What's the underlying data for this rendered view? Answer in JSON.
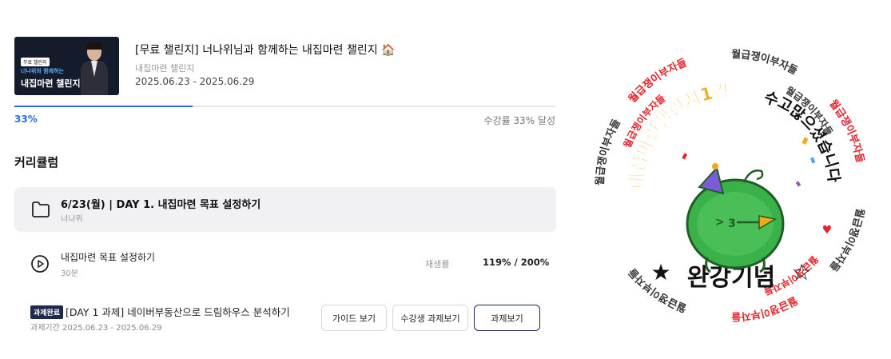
{
  "course": {
    "thumbnail": {
      "tag": "무료 챌린지",
      "subtitle": "너나위와 함께하는",
      "title": "내집마련 챌린지"
    },
    "title": "[무료 챌린지] 너나위님과 함께하는 내집마련 챌린지",
    "title_emoji": "🏠",
    "category": "내집마련 챌린지",
    "period": "2025.06.23 - 2025.06.29"
  },
  "progress": {
    "percent": 33,
    "percent_label": "33%",
    "status_text": "수강률 33% 달성",
    "accent_color": "#2b6de5"
  },
  "curriculum": {
    "heading": "커리큘럼",
    "chapter": {
      "icon": "folder-icon",
      "title": "6/23(월) | DAY 1. 내집마련 목표 설정하기",
      "author": "너나위"
    },
    "lesson": {
      "icon": "play-circle-icon",
      "title": "내집마련 목표 설정하기",
      "duration": "30분",
      "play_rate_label": "재생률",
      "play_rate_value": "119% / 200%"
    },
    "assignment": {
      "badge": "과제완료",
      "title": "[DAY 1 과제] 네이버부동산으로 드림하우스 분석하기",
      "period": "과제기간 2025.06.23 - 2025.06.29",
      "buttons": {
        "guide": "가이드 보기",
        "peer": "수강생 과제보기",
        "view": "과제보기"
      }
    }
  },
  "sticker": {
    "arc_left": "내집마련챌린지1강",
    "arc_right": "수고많으셨습니다",
    "bottom": "완강기념",
    "ring_text": "월급쟁이부자들",
    "arc_left_color": "#f3a81a",
    "ring_accent_color": "#e3242b",
    "character_color": "#3bb14a"
  }
}
